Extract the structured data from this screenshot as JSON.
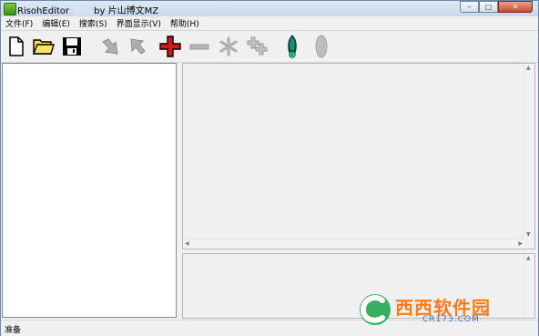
{
  "window": {
    "title": "RisohEditor ",
    "title_suffix": "by 片山博文MZ",
    "controls": {
      "minimize": "–",
      "maximize": "□",
      "close": "✕"
    }
  },
  "menu": [
    "文件(F)",
    "编辑(E)",
    "搜索(S)",
    "界面显示(V)",
    "帮助(H)"
  ],
  "toolbar": {
    "buttons": [
      {
        "name": "new-file-icon",
        "enabled": true
      },
      {
        "name": "open-folder-icon",
        "enabled": true
      },
      {
        "name": "save-icon",
        "enabled": true
      },
      {
        "name": "move-down-icon",
        "enabled": false
      },
      {
        "name": "move-up-icon",
        "enabled": false
      },
      {
        "name": "add-icon",
        "enabled": true
      },
      {
        "name": "remove-icon",
        "enabled": false
      },
      {
        "name": "asterisk-icon",
        "enabled": false
      },
      {
        "name": "duplicate-icon",
        "enabled": false
      },
      {
        "name": "test-icon",
        "enabled": true
      },
      {
        "name": "ellipse-icon",
        "enabled": false
      }
    ]
  },
  "status": {
    "text": "准备"
  },
  "watermark": {
    "brand": "西西软件园",
    "site": "CR173.COM"
  },
  "colors": {
    "add_red": "#d01818",
    "disabled_gray": "#a8a8a8",
    "accent_teal": "#1a8f7a"
  }
}
